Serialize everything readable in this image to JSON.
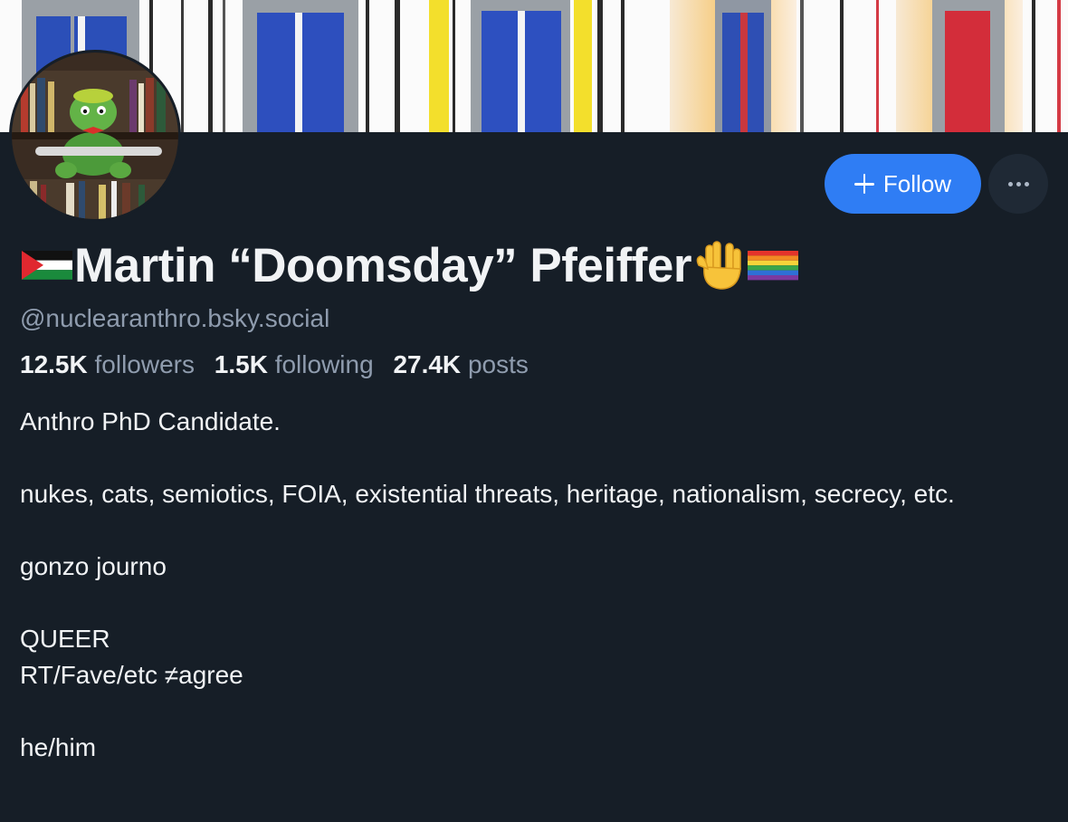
{
  "profile": {
    "display_name": "Martin “Doomsday” Pfeiffer",
    "handle": "@nuclearanthro.bsky.social",
    "stats": {
      "followers_count": "12.5K",
      "followers_label": "followers",
      "following_count": "1.5K",
      "following_label": "following",
      "posts_count": "27.4K",
      "posts_label": "posts"
    },
    "bio": [
      "Anthro PhD Candidate.",
      "nukes, cats, semiotics, FOIA, existential threats, heritage, nationalism, secrecy, etc.",
      "gonzo journo",
      "QUEER",
      "RT/Fave/etc ≠agree",
      "he/him"
    ]
  },
  "actions": {
    "follow_label": "Follow"
  },
  "icons": {
    "follow": "plus-icon",
    "more": "ellipsis-icon",
    "name_prefix": "palestine-flag-icon",
    "name_suffix": [
      "vulcan-salute-icon",
      "rainbow-flag-icon"
    ]
  },
  "colors": {
    "background": "#161e27",
    "accent": "#2f7df4",
    "text_primary": "#f1f3f5",
    "text_secondary": "#8f9cae",
    "button_secondary": "#1f2935"
  }
}
